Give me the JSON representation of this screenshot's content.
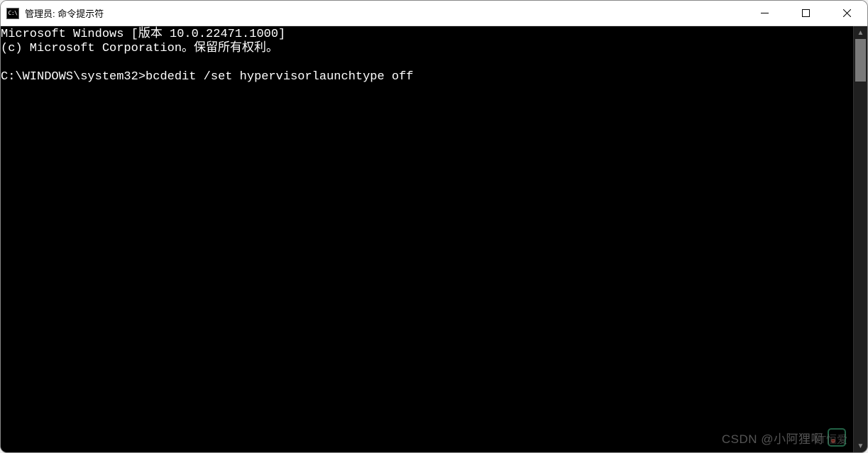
{
  "window": {
    "icon_text": "C:\\",
    "title": "管理员: 命令提示符"
  },
  "console": {
    "line1": "Microsoft Windows [版本 10.0.22471.1000]",
    "line2": "(c) Microsoft Corporation。保留所有权利。",
    "blank": "",
    "prompt": "C:\\WINDOWS\\system32>",
    "command": "bcdedit /set hypervisorlaunchtype off"
  },
  "watermark": {
    "left": "CSDN @小阿狸啊",
    "right_overlay": "LT恒爱"
  }
}
